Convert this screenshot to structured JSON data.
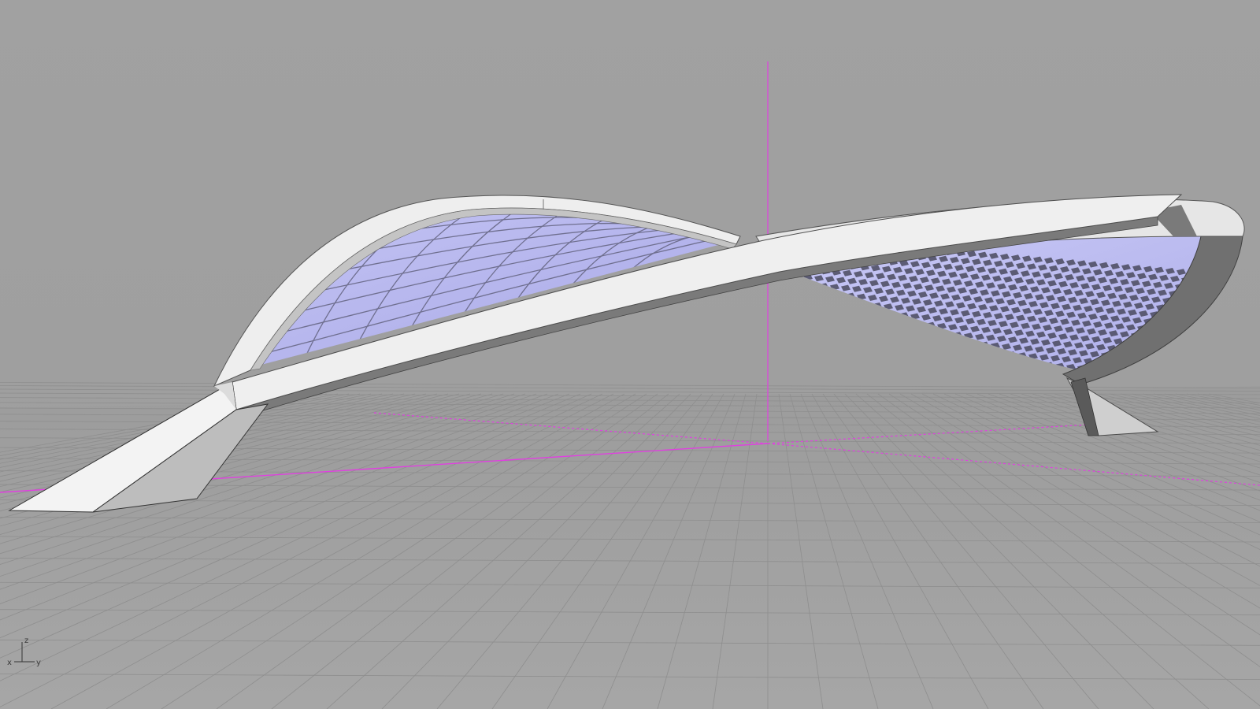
{
  "viewport": {
    "background": "#a0a0a0",
    "grid_color": "#8f8f8f",
    "axis_color": "#e040e0",
    "shell_color": "#ececec",
    "panel_color": "#b6b6ee"
  },
  "axis_widget": {
    "x_label": "x",
    "y_label": "y",
    "z_label": "z",
    "icon": "axis-triad-icon"
  }
}
